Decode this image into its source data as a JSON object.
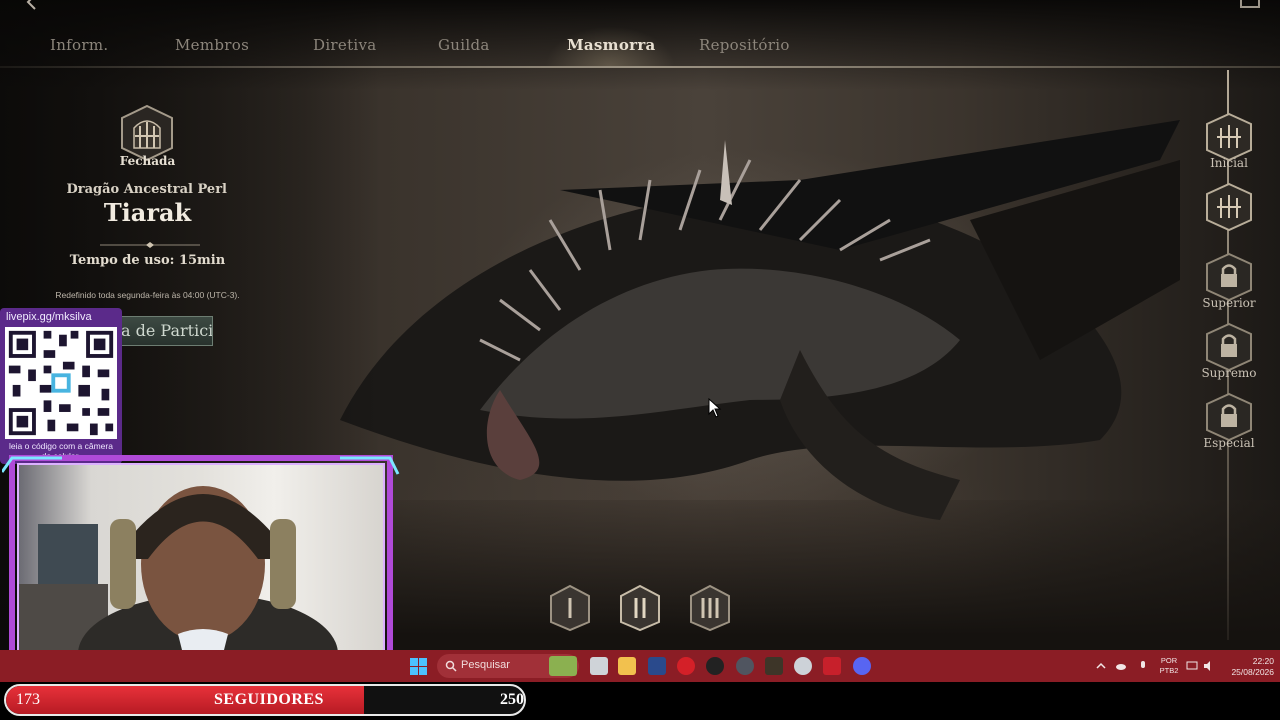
{
  "game": {
    "header_title": "Guilda",
    "tabs": [
      {
        "label": "Inform.",
        "active": false
      },
      {
        "label": "Membros",
        "active": false
      },
      {
        "label": "Diretiva",
        "active": false
      },
      {
        "label": "Guilda",
        "active": false
      },
      {
        "label": "Masmorra",
        "active": true
      },
      {
        "label": "Repositório",
        "active": false
      }
    ],
    "dungeon": {
      "status": "Fechada",
      "boss_subtitle": "Dragão Ancestral Perl",
      "boss_name": "Tiarak",
      "usage_time": "Tempo de uso: 15min",
      "reset_note": "Redefinido toda segunda-feira às 04:00 (UTC-3).",
      "join_button": "a de Partici"
    },
    "difficulties": [
      {
        "label": "Inicial",
        "locked": false
      },
      {
        "label": "",
        "locked": false
      },
      {
        "label": "Superior",
        "locked": true
      },
      {
        "label": "Supremo",
        "locked": true
      },
      {
        "label": "Especial",
        "locked": true
      }
    ]
  },
  "overlay": {
    "qr_url": "livepix.gg/mksilva",
    "qr_caption": "leia o código com a câmera do celular."
  },
  "taskbar": {
    "search_placeholder": "Pesquisar",
    "lang_line1": "POR",
    "lang_line2": "PTB2",
    "time": "22:20",
    "date": "25/08/2026",
    "icons": [
      "start-icon",
      "search-icon",
      "game-app-icon",
      "task-view-icon",
      "file-explorer-icon",
      "shield-app-icon",
      "opera-icon",
      "obs-icon",
      "chrome-like-icon",
      "game-launcher-icon",
      "ccleaner-icon",
      "app-grid-icon",
      "discord-icon"
    ]
  },
  "followers": {
    "current": "173",
    "label": "SEGUIDORES",
    "goal": "250",
    "progress": 0.692
  },
  "colors": {
    "taskbar": "#8b1d25",
    "follower_fill": "#e8313a",
    "overlay_purple": "#5b2a8a",
    "active_tab": "#e8e0d2"
  }
}
